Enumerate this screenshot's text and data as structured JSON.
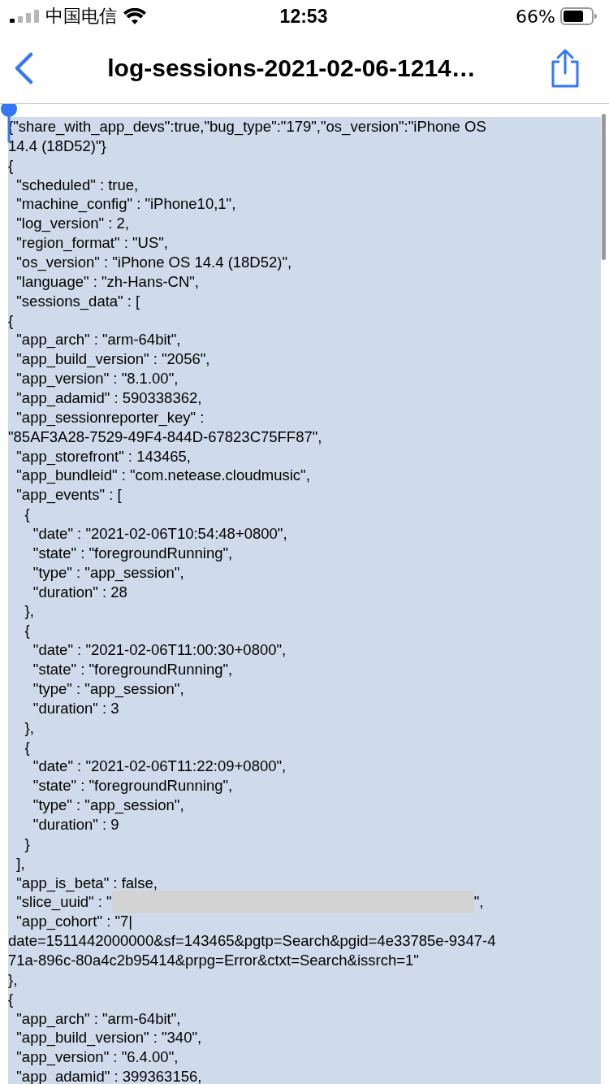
{
  "status_bar": {
    "carrier": "中国电信",
    "time": "12:53",
    "battery": "66%"
  },
  "nav": {
    "title": "log-sessions-2021-02-06-1214…"
  },
  "log": {
    "selected": true,
    "lines": [
      {
        "text": "{\"share_with_app_devs\":true,\"bug_type\":\"179\",\"os_version\":\"iPhone OS"
      },
      {
        "text": "14.4 (18D52)\"}"
      },
      {
        "text": "{"
      },
      {
        "text": "  \"scheduled\" : true,"
      },
      {
        "text": "  \"machine_config\" : \"iPhone10,1\","
      },
      {
        "text": "  \"log_version\" : 2,"
      },
      {
        "text": "  \"region_format\" : \"US\","
      },
      {
        "text": "  \"os_version\" : \"iPhone OS 14.4 (18D52)\","
      },
      {
        "text": "  \"language\" : \"zh-Hans-CN\","
      },
      {
        "text": "  \"sessions_data\" : ["
      },
      {
        "text": "{"
      },
      {
        "text": "  \"app_arch\" : \"arm-64bit\","
      },
      {
        "text": "  \"app_build_version\" : \"2056\","
      },
      {
        "text": "  \"app_version\" : \"8.1.00\","
      },
      {
        "text": "  \"app_adamid\" : 590338362,"
      },
      {
        "text": "  \"app_sessionreporter_key\" :"
      },
      {
        "text": "\"85AF3A28-7529-49F4-844D-67823C75FF87\","
      },
      {
        "text": "  \"app_storefront\" : 143465,"
      },
      {
        "text": "  \"app_bundleid\" : \"com.netease.cloudmusic\","
      },
      {
        "text": "  \"app_events\" : ["
      },
      {
        "text": "    {"
      },
      {
        "text": "      \"date\" : \"2021-02-06T10:54:48+0800\","
      },
      {
        "text": "      \"state\" : \"foregroundRunning\","
      },
      {
        "text": "      \"type\" : \"app_session\","
      },
      {
        "text": "      \"duration\" : 28"
      },
      {
        "text": "    },"
      },
      {
        "text": "    {"
      },
      {
        "text": "      \"date\" : \"2021-02-06T11:00:30+0800\","
      },
      {
        "text": "      \"state\" : \"foregroundRunning\","
      },
      {
        "text": "      \"type\" : \"app_session\","
      },
      {
        "text": "      \"duration\" : 3"
      },
      {
        "text": "    },"
      },
      {
        "text": "    {"
      },
      {
        "text": "      \"date\" : \"2021-02-06T11:22:09+0800\","
      },
      {
        "text": "      \"state\" : \"foregroundRunning\","
      },
      {
        "text": "      \"type\" : \"app_session\","
      },
      {
        "text": "      \"duration\" : 9"
      },
      {
        "text": "    }"
      },
      {
        "text": "  ],"
      },
      {
        "text": "  \"app_is_beta\" : false,"
      },
      {
        "kind": "redacted",
        "before": "  \"slice_uuid\" : \"",
        "after": "\","
      },
      {
        "text": "  \"app_cohort\" : \"7|"
      },
      {
        "text": "date=1511442000000&sf=143465&pgtp=Search&pgid=4e33785e-9347-4"
      },
      {
        "text": "71a-896c-80a4c2b95414&prpg=Error&ctxt=Search&issrch=1\""
      },
      {
        "text": "},"
      },
      {
        "text": "{"
      },
      {
        "text": "  \"app_arch\" : \"arm-64bit\","
      },
      {
        "text": "  \"app_build_version\" : \"340\","
      },
      {
        "text": "  \"app_version\" : \"6.4.00\","
      },
      {
        "text": "  \"app_adamid\" : 399363156,"
      }
    ]
  }
}
